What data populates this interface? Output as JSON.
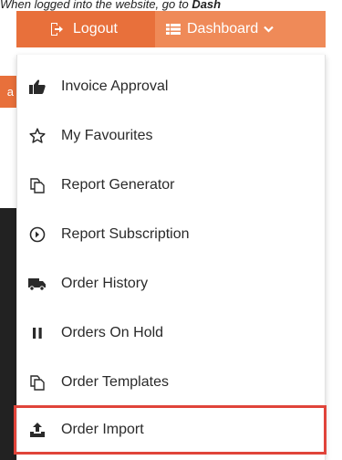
{
  "caption": {
    "prefix": "When logged into the website, go to ",
    "bold": "Dash"
  },
  "topbar": {
    "logout_label": "Logout",
    "dashboard_label": "Dashboard",
    "background": "#e8703b",
    "active_background": "#ef8a58"
  },
  "side_fragment": "a",
  "menu": {
    "items": [
      {
        "label": "Invoice Approval",
        "icon": "thumbs-up-icon"
      },
      {
        "label": "My Favourites",
        "icon": "star-outline-icon"
      },
      {
        "label": "Report Generator",
        "icon": "copy-icon"
      },
      {
        "label": "Report Subscription",
        "icon": "circle-arrow-icon"
      },
      {
        "label": "Order History",
        "icon": "truck-icon"
      },
      {
        "label": "Orders On Hold",
        "icon": "pause-icon"
      },
      {
        "label": "Order Templates",
        "icon": "copy-icon"
      },
      {
        "label": "Order Import",
        "icon": "upload-icon"
      }
    ],
    "highlighted_item": "Order Import",
    "highlight_color": "#e0443a"
  }
}
